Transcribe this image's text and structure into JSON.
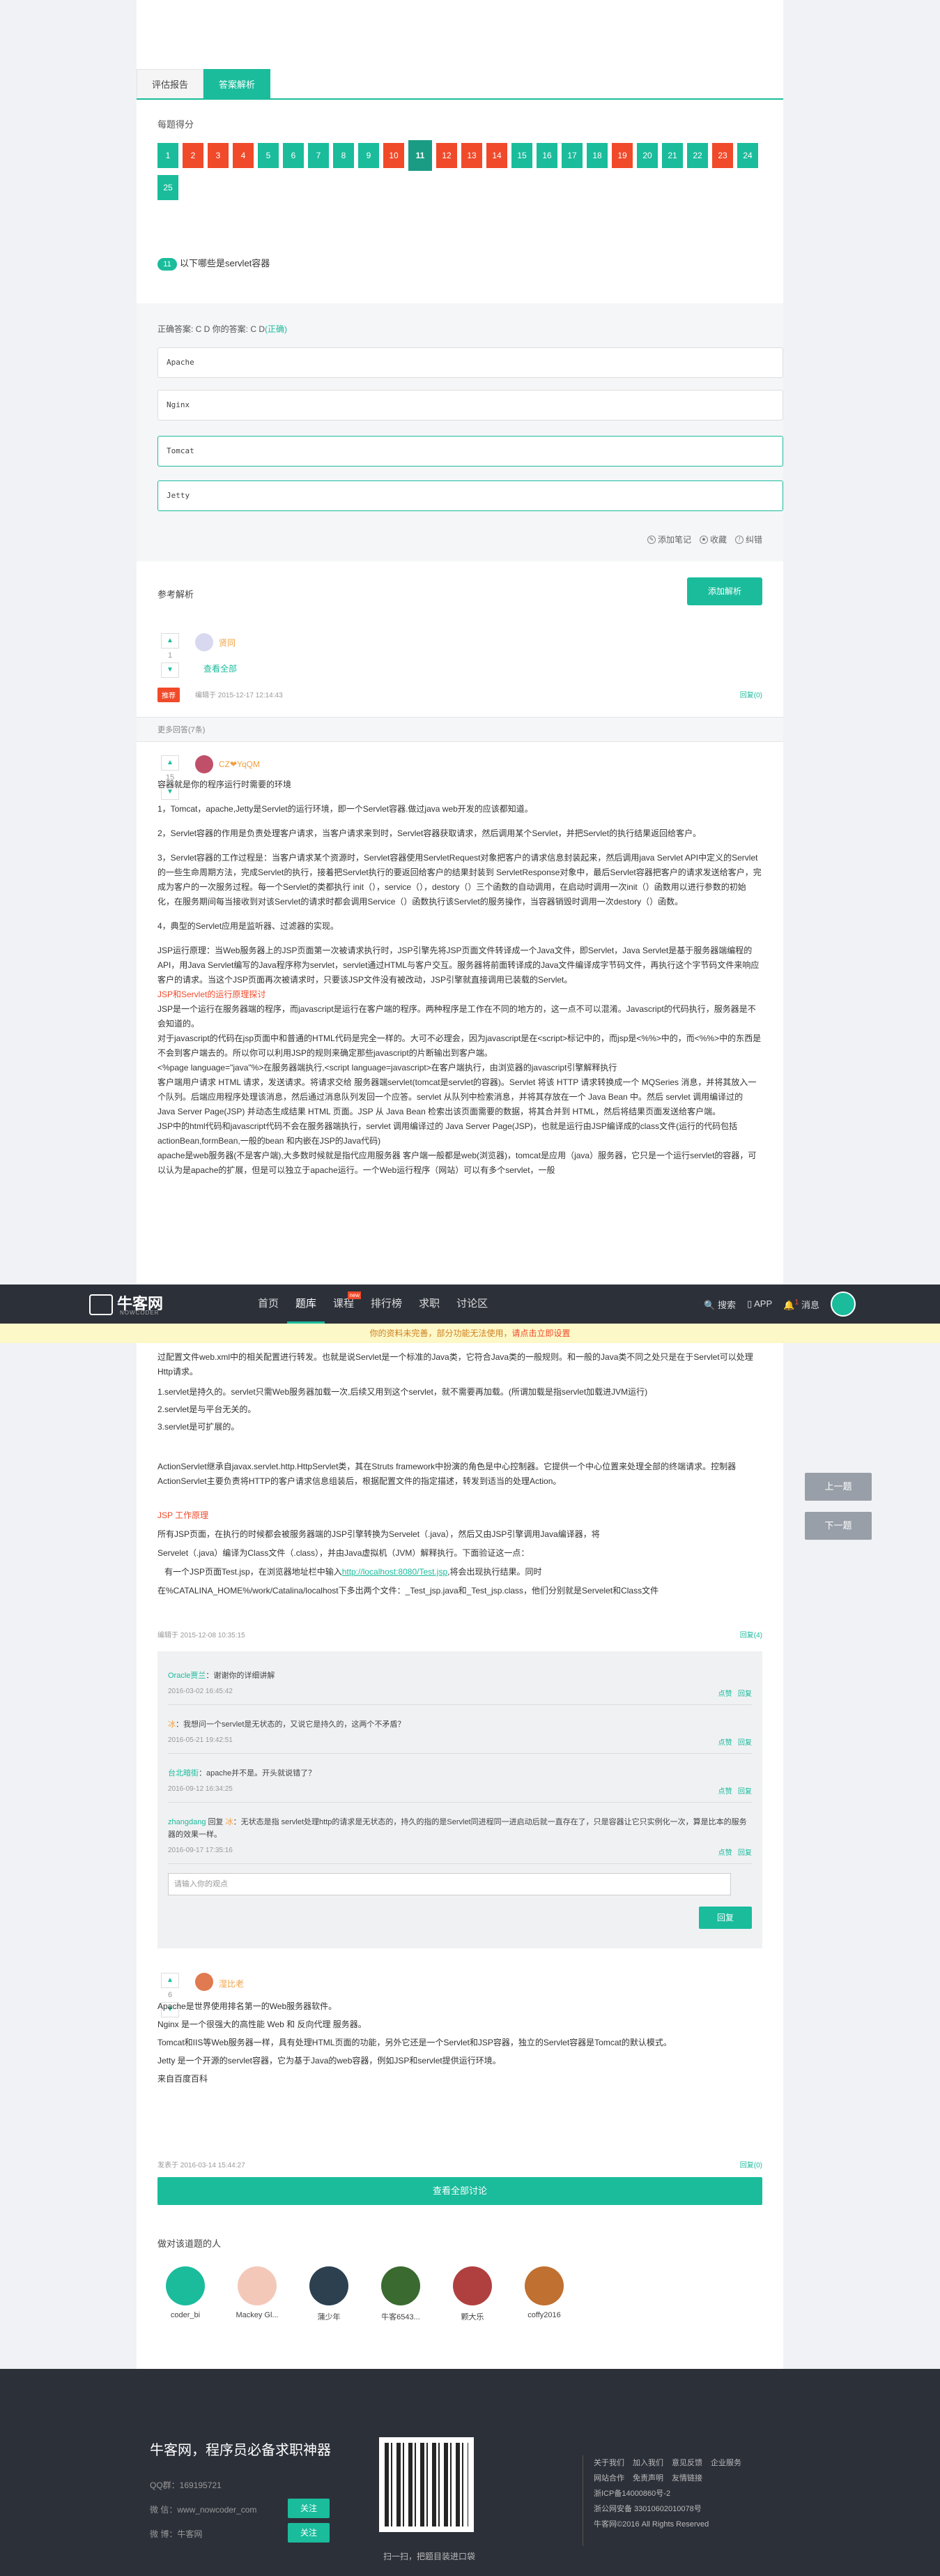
{
  "tabs": [
    "评估报告",
    "答案解析"
  ],
  "scores": {
    "title": "每题得分",
    "items": [
      {
        "n": "1",
        "s": "ok"
      },
      {
        "n": "2",
        "s": "bad"
      },
      {
        "n": "3",
        "s": "bad"
      },
      {
        "n": "4",
        "s": "bad"
      },
      {
        "n": "5",
        "s": "ok"
      },
      {
        "n": "6",
        "s": "ok"
      },
      {
        "n": "7",
        "s": "ok"
      },
      {
        "n": "8",
        "s": "ok"
      },
      {
        "n": "9",
        "s": "ok"
      },
      {
        "n": "10",
        "s": "bad"
      },
      {
        "n": "11",
        "s": "cur"
      },
      {
        "n": "12",
        "s": "bad"
      },
      {
        "n": "13",
        "s": "bad"
      },
      {
        "n": "14",
        "s": "bad"
      },
      {
        "n": "15",
        "s": "ok"
      },
      {
        "n": "16",
        "s": "ok"
      },
      {
        "n": "17",
        "s": "ok"
      },
      {
        "n": "18",
        "s": "ok"
      },
      {
        "n": "19",
        "s": "bad"
      },
      {
        "n": "20",
        "s": "ok"
      },
      {
        "n": "21",
        "s": "ok"
      },
      {
        "n": "22",
        "s": "ok"
      },
      {
        "n": "23",
        "s": "bad"
      },
      {
        "n": "24",
        "s": "ok"
      },
      {
        "n": "25",
        "s": "ok"
      }
    ]
  },
  "question": {
    "num": "11",
    "text": "以下哪些是servlet容器"
  },
  "answer": {
    "label": "正确答案: C D   你的答案: C D",
    "status": "(正确)",
    "options": [
      "Apache",
      "Nginx",
      "Tomcat",
      "Jetty"
    ],
    "tools": [
      "添加笔记",
      "收藏",
      "纠错"
    ]
  },
  "ref": {
    "title": "参考解析",
    "add_btn": "添加解析"
  },
  "first_answer": {
    "votes": "1",
    "user": "贤同",
    "sub": "查看全部",
    "time": "编辑于 2015-12-17 12:14:43",
    "reply": "回复(0)",
    "badge": "推荐"
  },
  "more": "更多回答(7条)",
  "second_answer": {
    "votes": "15",
    "user": "CZ❤YqQM",
    "title": "容器就是你的程序运行时需要的环境",
    "p1": "1，Tomcat，apache,Jetty是Servlet的运行环境，即一个Servlet容器.做过java web开发的应该都知道。",
    "p2": "2，Servlet容器的作用是负责处理客户请求，当客户请求来到时，Servlet容器获取请求，然后调用某个Servlet，并把Servlet的执行结果返回给客户。",
    "p3": "3，Servlet容器的工作过程是：当客户请求某个资源时，Servlet容器使用ServletRequest对象把客户的请求信息封装起来，然后调用java Servlet API中定义的Servlet的一些生命周期方法，完成Servlet的执行，接着把Servlet执行的要返回给客户的结果封装到 ServletResponse对象中，最后Servlet容器把客户的请求发送给客户，完成为客户的一次服务过程。每一个Servlet的类都执行 init（），service（），destory（）三个函数的自动调用，在启动时调用一次init（）函数用以进行参数的初始化，在服务期间每当接收到对该Servlet的请求时都会调用Service（）函数执行该Servlet的服务操作，当容器销毁时调用一次destory（）函数。",
    "p4": "4，典型的Servlet应用是监听器、过滤器的实现。",
    "p5": "JSP运行原理：当Web服务器上的JSP页面第一次被请求执行时，JSP引擎先将JSP页面文件转译成一个Java文件，即Servlet，Java Servlet是基于服务器端编程的API，用Java Servlet编写的Java程序称为servlet，servlet通过HTML与客户交互。服务器将前面转译成的Java文件编译成字节码文件，再执行这个字节码文件来响应客户的请求。当这个JSP页面再次被请求时，只要该JSP文件没有被改动，JSP引擎就直接调用已装载的Servlet。",
    "red_title": "JSP和Servlet的运行原理探讨",
    "p6": "JSP是一个运行在服务器端的程序，而javascript是运行在客户端的程序。两种程序是工作在不同的地方的，这一点不可以混淆。Javascript的代码执行，服务器是不会知道的。",
    "p7": "对于javascript的代码在jsp页面中和普通的HTML代码是完全一样的。大可不必理会，因为javascript是在<script>标记中的，而jsp是<%%>中的，而<%%>中的东西是不会到客户端去的。所以你可以利用JSP的规则来确定那些javascript的片断输出到客户端。",
    "p8": "<%page    language=\"java\"%>在服务器端执行,<script    language=javascript>在客户端执行，由浏览器的javascript引擎解释执行",
    "p9": "客户端用户请求 HTML 请求，发送请求。将请求交给 服务器端servlet(tomcat是servlet的容器)。Servlet 将该 HTTP 请求转换成一个 MQSeries 消息，并将其放入一个队列。后端应用程序处理该消息，然后通过消息队列发回一个应答。servlet 从队列中检索消息，并将其存放在一个 Java Bean 中。然后 servlet 调用编译过的 Java Server Page(JSP) 并动态生成结果 HTML 页面。JSP 从 Java Bean 检索出该页面需要的数据，将其合并到 HTML，然后将结果页面发送给客户端。",
    "p10": "JSP中的html代码和javascript代码不会在服务器端执行，servlet 调用编译过的 Java Server Page(JSP)，也就是运行由JSP编译成的class文件(运行的代码包括actionBean,formBean,一般的bean 和内嵌在JSP的Java代码)",
    "p11": "apache是web服务器(不是客户端),大多数时候就是指代应用服务器 客户端一般都是web(浏览器)，tomcat是应用（java）服务器，它只是一个运行servlet的容器，可以认为是apache的扩展，但是可以独立于apache运行。一个Web运行程序（网站）可以有多个servlet，一般",
    "p12": "过配置文件web.xml中的相关配置进行转发。也就是说Servlet是一个标准的Java类，它符合Java类的一般规则。和一般的Java类不同之处只是在于Servlet可以处理Http请求。",
    "l1": "1.servlet是持久的。servlet只需Web服务器加载一次,后续又用到这个servlet，就不需要再加载。(所谓加载是指servlet加载进JVM运行)",
    "l2": "2.servlet是与平台无关的。",
    "l3": "3.servlet是可扩展的。",
    "p13": "ActionServlet继承自javax.servlet.http.HttpServlet类，其在Struts framework中扮演的角色是中心控制器。它提供一个中心位置来处理全部的终端请求。控制器ActionServlet主要负责将HTTP的客户请求信息组装后，根据配置文件的指定描述，转发到适当的处理Action。",
    "red2": "JSP 工作原理",
    "p14a": "所有JSP页面，在执行的时候都会被服务器端的JSP引擎转换为Servelet（.java），然后又由JSP引擎调用Java编译器，将",
    "p14b": "Servelet（.java）编译为Class文件（.class），并由Java虚拟机（JVM）解释执行。下面验证这一点：",
    "p15a": "有一个JSP页面Test.jsp，在浏览器地址栏中输入",
    "p15link": "http://localhost:8080/Test.jsp",
    "p15b": ",将会出现执行结果。同时",
    "p16": "在%CATALINA_HOME%/work/Catalina/localhost下多出两个文件：_Test_jsp.java和_Test_jsp.class，他们分别就是Servelet和Class文件",
    "time": "编辑于 2015-12-08 10:35:15",
    "reply": "回复(4)"
  },
  "comments": [
    {
      "who": "Oracle贾兰",
      "text": "谢谢你的详细讲解",
      "time": "2016-03-02 16:45:42",
      "acts": [
        "点赞",
        "回复"
      ]
    },
    {
      "who": "冰",
      "text": "我想问一个servlet是无状态的，又说它是持久的，这两个不矛盾？",
      "time": "2016-05-21 19:42:51",
      "acts": [
        "点赞",
        "回复"
      ]
    },
    {
      "who": "台北暗街",
      "text": "apache并不是。开头就说错了？",
      "time": "2016-09-12 16:34:25",
      "acts": [
        "点赞",
        "回复"
      ]
    },
    {
      "who": "zhangdang",
      "prefix": "回复",
      "target": "冰",
      "text": "无状态是指 servlet处理http的请求是无状态的，持久的指的是Servlet同进程同一进启动后就一直存在了，只是容器让它只实例化一次，算是比本的服务器的效果一样。",
      "time": "2016-09-17 17:35:16",
      "acts": [
        "点赞",
        "回复"
      ]
    }
  ],
  "comment_input": {
    "placeholder": "请输入你的观点",
    "send": "回复"
  },
  "third_answer": {
    "votes": "6",
    "user": "湿比老",
    "l1": "Apache是世界使用排名第一的Web服务器软件。",
    "l2": "Nginx 是一个很强大的高性能 Web 和 反向代理 服务器。",
    "l3": "Tomcat和IIS等Web服务器一样，具有处理HTML页面的功能，另外它还是一个Servlet和JSP容器，独立的Servlet容器是Tomcat的默认模式。",
    "l4": "Jetty 是一个开源的servlet容器，它为基于Java的web容器，例如JSP和servlet提供运行环境。",
    "l5": "来自百度百科",
    "time": "发表于 2016-03-14 15:44:27",
    "reply": "回复(0)"
  },
  "view_all": "查看全部讨论",
  "people": {
    "title": "做对该道题的人",
    "list": [
      "coder_bi",
      "Mackey Gl...",
      "蒲少年",
      "牛客6543...",
      "颗大乐",
      "coffy2016"
    ]
  },
  "navbar": {
    "logo": "牛客网",
    "logo_sub": "NOWCODER",
    "items": [
      "首页",
      "题库",
      "课程",
      "排行榜",
      "求职",
      "讨论区"
    ],
    "active": "题库",
    "new_badge": "new",
    "right": [
      "搜索",
      "APP",
      "消息"
    ],
    "msg_count": "1"
  },
  "notice": {
    "text": "你的资料未完善，部分功能无法使用，",
    "link": "请点击立即设置"
  },
  "side": {
    "prev": "上一题",
    "next": "下一题"
  },
  "footer": {
    "title": "牛客网，程序员必备求职神器",
    "qq": "QQ群：169195721",
    "weixin1": "微 信：www_nowcoder_com",
    "weixin2": "微 博：牛客网",
    "follow": "关注",
    "qr_caption": "扫一扫，把题目装进口袋",
    "links_row1": [
      "关于我们",
      "加入我们",
      "意见反馈",
      "企业服务"
    ],
    "links_row2": [
      "网站合作",
      "免责声明",
      "友情链接"
    ],
    "icp": "浙ICP备14000860号-2",
    "police": "浙公网安备 33010602010078号",
    "copy": "牛客网©2016 All Rights Reserved"
  }
}
